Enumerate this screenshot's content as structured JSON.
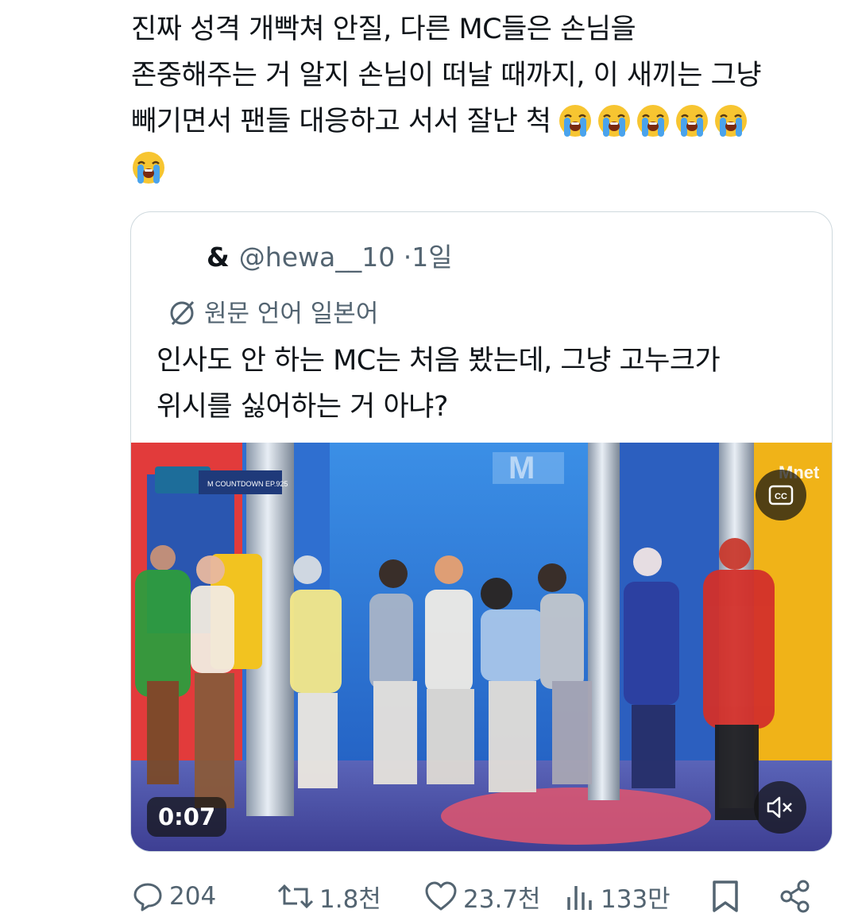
{
  "post": {
    "lines": [
      "진짜 성격 개빡쳐 안질, 다른 MC들은 손님을",
      "존중해주는 거 알지 손님이 떠날 때까지, 이 새끼는 그냥",
      "빼기면서 팬들 대응하고 서서 잘난 척"
    ],
    "emoji_count_line3": 5,
    "emoji_count_line4": 1,
    "emoji_name": "loudly-crying-face"
  },
  "quote": {
    "author": "&",
    "handle": "@hewa__10",
    "dot": "·",
    "age": "1일",
    "translate_label": "원문 언어 일본어",
    "text_lines": [
      "인사도 안 하는 MC는 처음 봤는데, 그냥 고누크가",
      "위시를 싫어하는 거 아냐?"
    ],
    "video": {
      "timestamp": "0:07",
      "cc_label": "CC",
      "muted": true,
      "overlay_brand": "Mnet",
      "overlay_show": "M COUNTDOWN EP.925"
    }
  },
  "actions": {
    "replies": "204",
    "reposts": "1.8천",
    "likes": "23.7천",
    "views": "133만"
  },
  "colors": {
    "text": "#0f1419",
    "muted": "#536471",
    "border": "#cfd9de",
    "stage_blue": "#2f78d6"
  }
}
